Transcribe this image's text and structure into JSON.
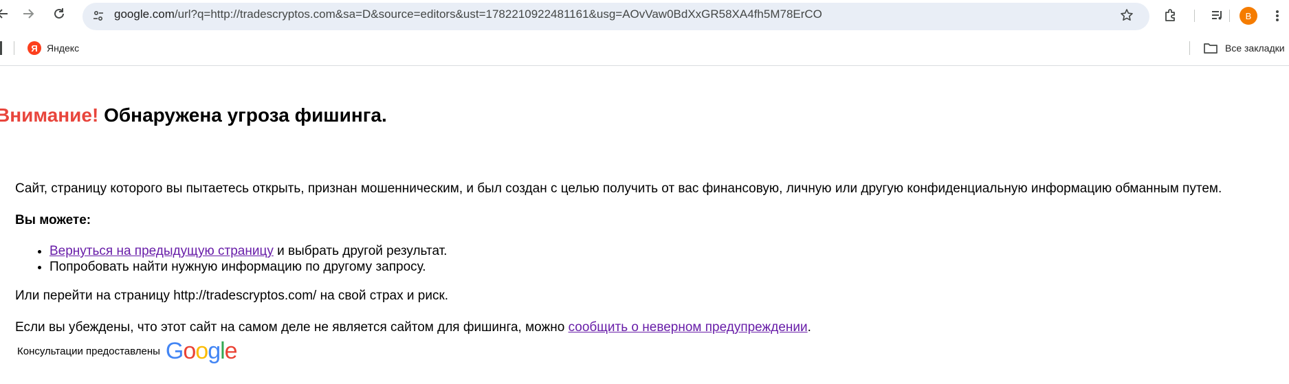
{
  "browser": {
    "url_domain": "google.com",
    "url_rest": "/url?q=http://tradescryptos.com&sa=D&source=editors&ust=1782210922481161&usg=AOvVaw0BdXxGR58XA4fh5M78ErCO",
    "avatar_letter": "B",
    "icons": [
      "back-arrow-icon",
      "forward-arrow-icon",
      "reload-icon",
      "site-info-icon",
      "star-icon",
      "extensions-icon",
      "media-icon",
      "menu-dots-icon"
    ]
  },
  "bookmarks": {
    "yandex_logo": "Я",
    "yandex_label": "Яндекс",
    "all_bookmarks_label": "Все закладки"
  },
  "page": {
    "title_warning": "Внимание!",
    "title_text": " Обнаружена угроза фишинга.",
    "intro": "Сайт, страницу которого вы пытаетесь открыть, признан мошенническим, и был создан с целью получить от вас финансовую, личную или другую конфиденциальную информацию обманным путем.",
    "you_can": "Вы можете:",
    "option1_link": "Вернуться на предыдущую страницу",
    "option1_rest": " и выбрать другой результат.",
    "option2": "Попробовать найти нужную информацию по другому запросу.",
    "proceed": "Или перейти на страницу http://tradescryptos.com/ на свой страх и риск.",
    "report_prefix": "Если вы убеждены, что этот сайт на самом деле не является сайтом для фишинга, можно ",
    "report_link": "сообщить о неверном предупреждении",
    "report_suffix": ".",
    "credit": "Консультации предоставлены",
    "google_logo": "Google",
    "colors": {
      "warning": "#e8453c",
      "link_visited": "#681da8"
    }
  }
}
